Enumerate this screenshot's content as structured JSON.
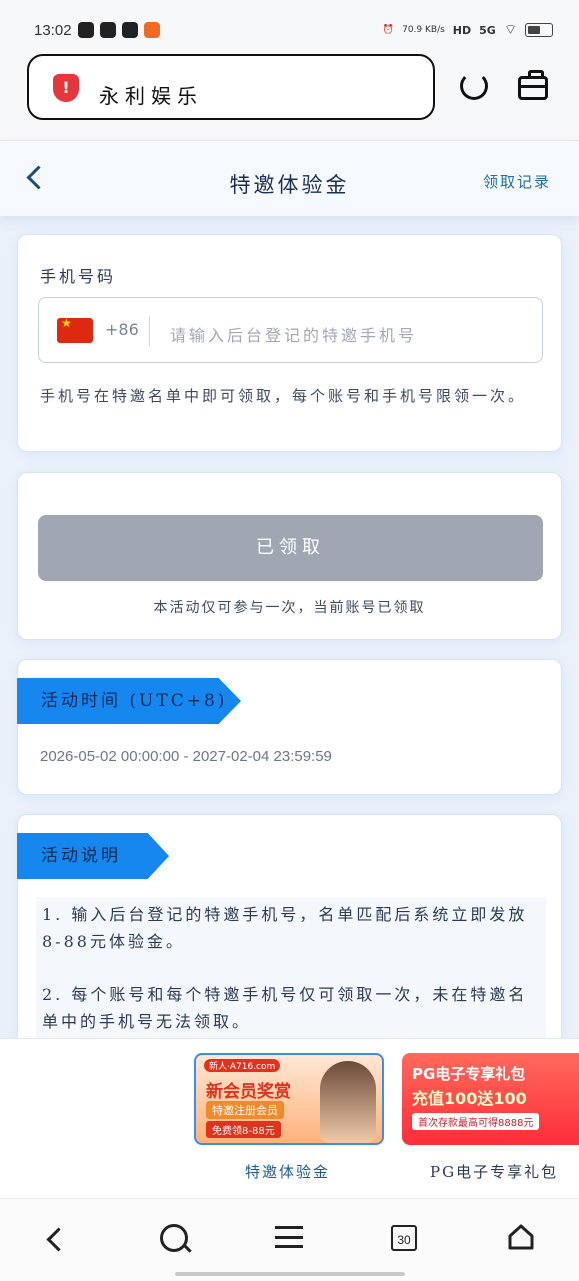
{
  "status_bar": {
    "time": "13:02",
    "net_speed": "70.9 KB/s",
    "hd": "HD",
    "signal": "5G"
  },
  "browser": {
    "url_title": "永利娱乐",
    "tab_count": "30"
  },
  "header": {
    "title": "特邀体验金",
    "records_link": "领取记录"
  },
  "phone_section": {
    "label": "手机号码",
    "country_code": "+86",
    "placeholder": "请输入后台登记的特邀手机号",
    "hint": "手机号在特邀名单中即可领取，每个账号和手机号限领一次。"
  },
  "claim_section": {
    "button_label": "已领取",
    "note": "本活动仅可参与一次，当前账号已领取"
  },
  "period_section": {
    "tag": "活动时间 (UTC+8)",
    "range": "2026-05-02 00:00:00 - 2027-02-04 23:59:59"
  },
  "rules_section": {
    "tag": "活动说明",
    "items": [
      "1. 输入后台登记的特邀手机号，名单匹配后系统立即发放8-88元体验金。",
      "2. 每个账号和每个特邀手机号仅可领取一次，未在特邀名单中的手机号无法领取。"
    ]
  },
  "promos": [
    {
      "badge": "新人·A716.com",
      "title": "新会员奖赏",
      "subtitle": "特邀注册会员",
      "meta": "免费领8-88元",
      "label": "特邀体验金"
    },
    {
      "title": "PG电子专享礼包",
      "subtitle": "充值100送100",
      "meta": "首次存款最高可得8888元",
      "label": "PG电子专享礼包"
    }
  ]
}
